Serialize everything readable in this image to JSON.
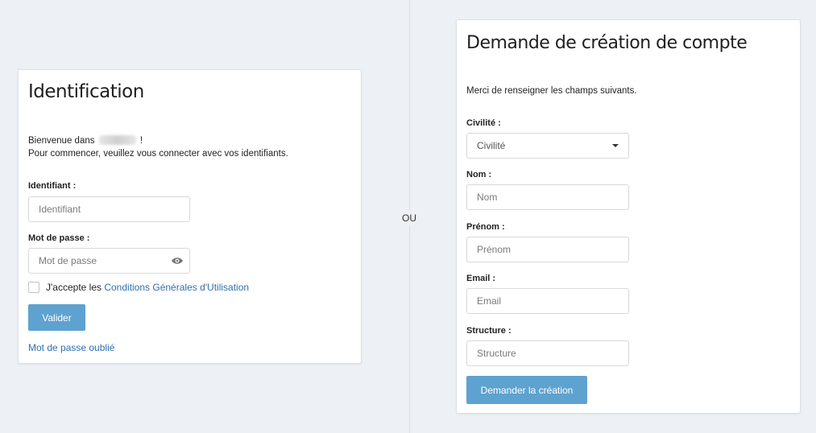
{
  "separator": "OU",
  "login": {
    "title": "Identification",
    "welcome_prefix": "Bienvenue dans",
    "welcome_suffix": "!",
    "intro": "Pour commencer, veuillez vous connecter avec vos identifiants.",
    "identifiant_label": "Identifiant :",
    "identifiant_placeholder": "Identifiant",
    "password_label": "Mot de passe :",
    "password_placeholder": "Mot de passe",
    "accept_prefix": "J'accepte les",
    "cgu_link": "Conditions Générales d'Utilisation",
    "submit": "Valider",
    "forgot": "Mot de passe oublié"
  },
  "signup": {
    "title": "Demande de création de compte",
    "intro": "Merci de renseigner les champs suivants.",
    "civilite_label": "Civilité :",
    "civilite_selected": "Civilité",
    "nom_label": "Nom :",
    "nom_placeholder": "Nom",
    "prenom_label": "Prénom :",
    "prenom_placeholder": "Prénom",
    "email_label": "Email :",
    "email_placeholder": "Email",
    "structure_label": "Structure :",
    "structure_placeholder": "Structure",
    "submit": "Demander la création"
  }
}
